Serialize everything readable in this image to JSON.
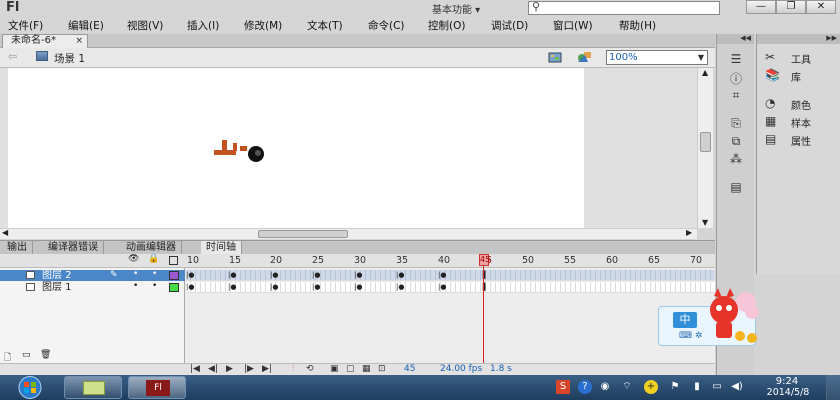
{
  "app": {
    "logo": "Fl",
    "workspace": "基本功能",
    "window_controls": {
      "minimize": "—",
      "restore": "❐",
      "close": "✕"
    }
  },
  "menu": [
    "文件(F)",
    "编辑(E)",
    "视图(V)",
    "插入(I)",
    "修改(M)",
    "文本(T)",
    "命令(C)",
    "控制(O)",
    "调试(D)",
    "窗口(W)",
    "帮助(H)"
  ],
  "document": {
    "tab_title": "未命名-6*",
    "tab_close": "×",
    "scene_label": "场景 1",
    "zoom": "100%"
  },
  "panel_tabs": [
    "输出",
    "编译器错误",
    "动画编辑器",
    "时间轴"
  ],
  "timeline": {
    "frame_numbers": [
      "10",
      "15",
      "20",
      "25",
      "30",
      "35",
      "40",
      "45",
      "50",
      "55",
      "60",
      "65",
      "70"
    ],
    "playhead_frame": "45",
    "layers": [
      {
        "name": "图层 2",
        "selected": true,
        "color": "#9b59d0"
      },
      {
        "name": "图层 1",
        "selected": false,
        "color": "#44dd44"
      }
    ],
    "status": {
      "frame": "45",
      "fps": "24.00 fps",
      "elapsed": "1.8 s"
    }
  },
  "right_dock": {
    "items": [
      {
        "icon": "tools-icon",
        "label": "工具"
      },
      {
        "icon": "library-icon",
        "label": "库"
      },
      {
        "icon": "color-icon",
        "label": "颜色"
      },
      {
        "icon": "swatches-icon",
        "label": "样本"
      },
      {
        "icon": "properties-icon",
        "label": "属性"
      }
    ]
  },
  "ime": {
    "mode": "中"
  },
  "taskbar": {
    "time": "9:24",
    "date": "2014/5/8"
  },
  "colors": {
    "accent": "#4a86c8",
    "playhead": "#dd2222",
    "stage_object": "#c0531f"
  }
}
